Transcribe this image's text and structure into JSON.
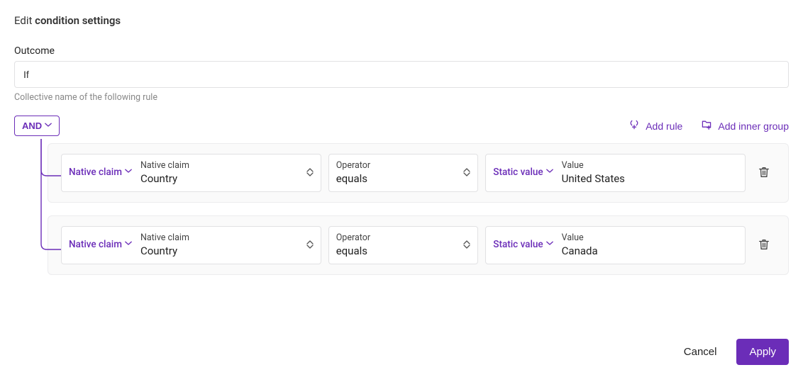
{
  "title": {
    "prefix": "Edit ",
    "bold": "condition settings"
  },
  "outcome": {
    "label": "Outcome",
    "value": "If",
    "hint": "Collective name of the following rule"
  },
  "logic": {
    "operator": "AND"
  },
  "actions": {
    "add_rule": "Add rule",
    "add_inner_group": "Add inner group"
  },
  "field_labels": {
    "native_claim": "Native claim",
    "operator": "Operator",
    "value": "Value"
  },
  "chips": {
    "native_claim": "Native claim",
    "static_value": "Static value"
  },
  "rules": [
    {
      "left_value": "Country",
      "operator_value": "equals",
      "right_value": "United States"
    },
    {
      "left_value": "Country",
      "operator_value": "equals",
      "right_value": "Canada"
    }
  ],
  "footer": {
    "cancel": "Cancel",
    "apply": "Apply"
  }
}
